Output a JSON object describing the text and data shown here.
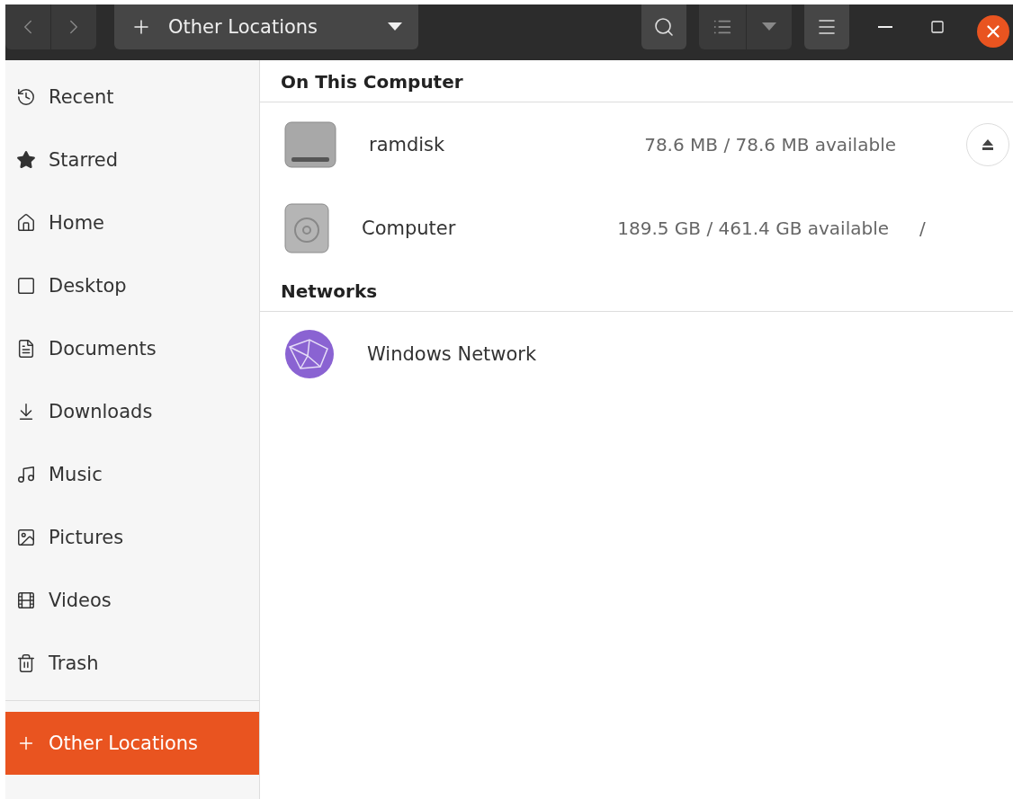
{
  "header": {
    "location": {
      "label": "Other Locations"
    }
  },
  "sidebar": {
    "items": [
      {
        "label": "Recent",
        "kind": "recent",
        "selected": false
      },
      {
        "label": "Starred",
        "kind": "starred",
        "selected": false
      },
      {
        "label": "Home",
        "kind": "home",
        "selected": false
      },
      {
        "label": "Desktop",
        "kind": "desktop",
        "selected": false
      },
      {
        "label": "Documents",
        "kind": "documents",
        "selected": false
      },
      {
        "label": "Downloads",
        "kind": "downloads",
        "selected": false
      },
      {
        "label": "Music",
        "kind": "music",
        "selected": false
      },
      {
        "label": "Pictures",
        "kind": "pictures",
        "selected": false
      },
      {
        "label": "Videos",
        "kind": "videos",
        "selected": false
      },
      {
        "label": "Trash",
        "kind": "trash",
        "selected": false
      },
      {
        "label": "Other Locations",
        "kind": "other",
        "selected": true
      }
    ]
  },
  "sections": [
    {
      "title": "On This Computer",
      "items": [
        {
          "name": "ramdisk",
          "kind": "drive",
          "usage": "78.6 MB / 78.6 MB available",
          "eject": true
        },
        {
          "name": "Computer",
          "kind": "disk",
          "usage": "189.5 GB / 461.4 GB available",
          "mount": "/",
          "eject": false
        }
      ]
    },
    {
      "title": "Networks",
      "items": [
        {
          "name": "Windows Network",
          "kind": "network",
          "eject": false
        }
      ]
    }
  ]
}
